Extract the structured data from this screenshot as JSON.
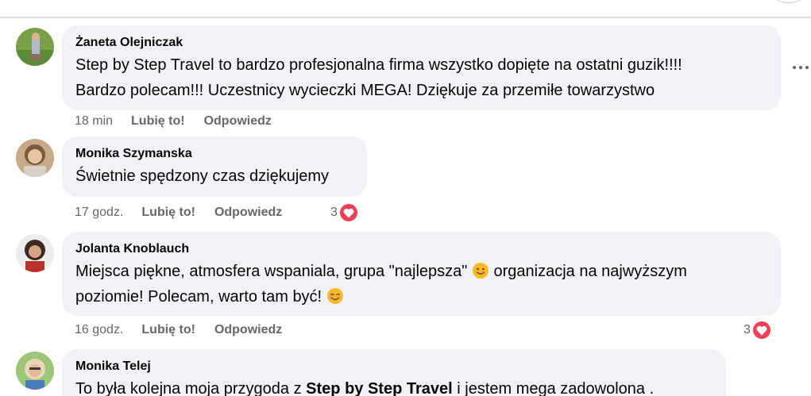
{
  "comments": [
    {
      "author": "Żaneta Olejniczak",
      "lines": [
        "Step by Step Travel to bardzo profesjonalna firma wszystko dopięte na ostatni guzik!!!!",
        "Bardzo polecam!!! Uczestnicy wycieczki MEGA! Dziękuje za przemiłe towarzystwo"
      ],
      "time": "18 min",
      "like_label": "Lubię to!",
      "reply_label": "Odpowiedz"
    },
    {
      "author": "Monika Szymanska",
      "lines": [
        "Świetnie spędzony czas dziękujemy"
      ],
      "time": "17 godz.",
      "like_label": "Lubię to!",
      "reply_label": "Odpowiedz",
      "reaction_count": "3"
    },
    {
      "author": "Jolanta Knoblauch",
      "line1_before": "Miejsca piękne, atmosfera wspaniala, grupa \"najlepsza\"",
      "line1_after": "organizacja na najwyższym",
      "line2": "poziomie! Polecam, warto tam być!",
      "time": "16 godz.",
      "like_label": "Lubię to!",
      "reply_label": "Odpowiedz",
      "reaction_count": "3"
    },
    {
      "author": "Monika Telej",
      "line_before": "To była kolejna moja przygoda z",
      "line_bold": "Step by Step Travel",
      "line_after": "i jestem mega zadowolona ."
    }
  ],
  "icons": {
    "more": "more-horizontal-icon",
    "reaction": "heart-reaction-icon",
    "smile": "slightly-smiling-emoji",
    "blush": "smiling-eyes-emoji"
  },
  "colors": {
    "bubble": "#f0f2f5",
    "heart": "#f33e58",
    "meta": "#65676b",
    "emoji": "#f7b928"
  }
}
